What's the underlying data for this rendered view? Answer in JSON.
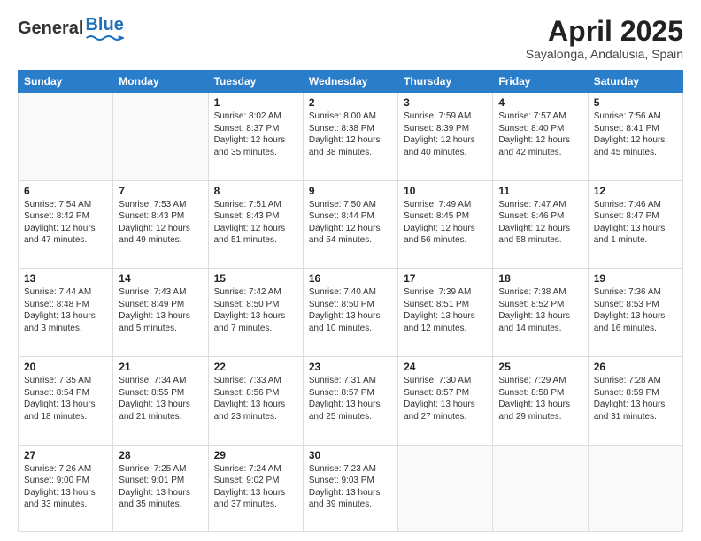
{
  "header": {
    "logo_general": "General",
    "logo_blue": "Blue",
    "month_title": "April 2025",
    "subtitle": "Sayalonga, Andalusia, Spain"
  },
  "weekdays": [
    "Sunday",
    "Monday",
    "Tuesday",
    "Wednesday",
    "Thursday",
    "Friday",
    "Saturday"
  ],
  "cells": [
    {
      "day": "",
      "text": ""
    },
    {
      "day": "",
      "text": ""
    },
    {
      "day": "1",
      "text": "Sunrise: 8:02 AM\nSunset: 8:37 PM\nDaylight: 12 hours and 35 minutes."
    },
    {
      "day": "2",
      "text": "Sunrise: 8:00 AM\nSunset: 8:38 PM\nDaylight: 12 hours and 38 minutes."
    },
    {
      "day": "3",
      "text": "Sunrise: 7:59 AM\nSunset: 8:39 PM\nDaylight: 12 hours and 40 minutes."
    },
    {
      "day": "4",
      "text": "Sunrise: 7:57 AM\nSunset: 8:40 PM\nDaylight: 12 hours and 42 minutes."
    },
    {
      "day": "5",
      "text": "Sunrise: 7:56 AM\nSunset: 8:41 PM\nDaylight: 12 hours and 45 minutes."
    },
    {
      "day": "6",
      "text": "Sunrise: 7:54 AM\nSunset: 8:42 PM\nDaylight: 12 hours and 47 minutes."
    },
    {
      "day": "7",
      "text": "Sunrise: 7:53 AM\nSunset: 8:43 PM\nDaylight: 12 hours and 49 minutes."
    },
    {
      "day": "8",
      "text": "Sunrise: 7:51 AM\nSunset: 8:43 PM\nDaylight: 12 hours and 51 minutes."
    },
    {
      "day": "9",
      "text": "Sunrise: 7:50 AM\nSunset: 8:44 PM\nDaylight: 12 hours and 54 minutes."
    },
    {
      "day": "10",
      "text": "Sunrise: 7:49 AM\nSunset: 8:45 PM\nDaylight: 12 hours and 56 minutes."
    },
    {
      "day": "11",
      "text": "Sunrise: 7:47 AM\nSunset: 8:46 PM\nDaylight: 12 hours and 58 minutes."
    },
    {
      "day": "12",
      "text": "Sunrise: 7:46 AM\nSunset: 8:47 PM\nDaylight: 13 hours and 1 minute."
    },
    {
      "day": "13",
      "text": "Sunrise: 7:44 AM\nSunset: 8:48 PM\nDaylight: 13 hours and 3 minutes."
    },
    {
      "day": "14",
      "text": "Sunrise: 7:43 AM\nSunset: 8:49 PM\nDaylight: 13 hours and 5 minutes."
    },
    {
      "day": "15",
      "text": "Sunrise: 7:42 AM\nSunset: 8:50 PM\nDaylight: 13 hours and 7 minutes."
    },
    {
      "day": "16",
      "text": "Sunrise: 7:40 AM\nSunset: 8:50 PM\nDaylight: 13 hours and 10 minutes."
    },
    {
      "day": "17",
      "text": "Sunrise: 7:39 AM\nSunset: 8:51 PM\nDaylight: 13 hours and 12 minutes."
    },
    {
      "day": "18",
      "text": "Sunrise: 7:38 AM\nSunset: 8:52 PM\nDaylight: 13 hours and 14 minutes."
    },
    {
      "day": "19",
      "text": "Sunrise: 7:36 AM\nSunset: 8:53 PM\nDaylight: 13 hours and 16 minutes."
    },
    {
      "day": "20",
      "text": "Sunrise: 7:35 AM\nSunset: 8:54 PM\nDaylight: 13 hours and 18 minutes."
    },
    {
      "day": "21",
      "text": "Sunrise: 7:34 AM\nSunset: 8:55 PM\nDaylight: 13 hours and 21 minutes."
    },
    {
      "day": "22",
      "text": "Sunrise: 7:33 AM\nSunset: 8:56 PM\nDaylight: 13 hours and 23 minutes."
    },
    {
      "day": "23",
      "text": "Sunrise: 7:31 AM\nSunset: 8:57 PM\nDaylight: 13 hours and 25 minutes."
    },
    {
      "day": "24",
      "text": "Sunrise: 7:30 AM\nSunset: 8:57 PM\nDaylight: 13 hours and 27 minutes."
    },
    {
      "day": "25",
      "text": "Sunrise: 7:29 AM\nSunset: 8:58 PM\nDaylight: 13 hours and 29 minutes."
    },
    {
      "day": "26",
      "text": "Sunrise: 7:28 AM\nSunset: 8:59 PM\nDaylight: 13 hours and 31 minutes."
    },
    {
      "day": "27",
      "text": "Sunrise: 7:26 AM\nSunset: 9:00 PM\nDaylight: 13 hours and 33 minutes."
    },
    {
      "day": "28",
      "text": "Sunrise: 7:25 AM\nSunset: 9:01 PM\nDaylight: 13 hours and 35 minutes."
    },
    {
      "day": "29",
      "text": "Sunrise: 7:24 AM\nSunset: 9:02 PM\nDaylight: 13 hours and 37 minutes."
    },
    {
      "day": "30",
      "text": "Sunrise: 7:23 AM\nSunset: 9:03 PM\nDaylight: 13 hours and 39 minutes."
    },
    {
      "day": "",
      "text": ""
    },
    {
      "day": "",
      "text": ""
    },
    {
      "day": "",
      "text": ""
    }
  ]
}
